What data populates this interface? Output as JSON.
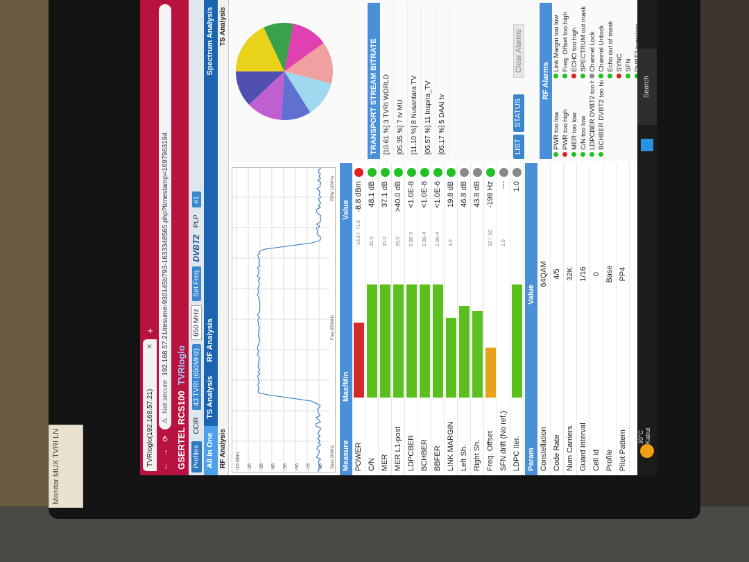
{
  "browser": {
    "tab_title": "TVRIoglo(192.168.57.21)",
    "not_secure": "Not secure",
    "url": "192.168.57.21/resume-930145b793-1633348565.php?timestamp=1697963194"
  },
  "app": {
    "brand": "GSERTEL RCS100",
    "device": "TVRIoglo"
  },
  "toolbar": {
    "profiles": "Profiles",
    "ccir": "CCIR",
    "channel": "43 TVRI (650MHz)",
    "freq": "650 MHz",
    "set_freq": "Set Freq",
    "dvb": "DVBT2",
    "plp": "PLP",
    "plp_val": "#1"
  },
  "tabs": {
    "all_in_one": "All In One",
    "ts_analysis": "TS Analysis",
    "rf_analysis": "RF Analysis",
    "spectrum": "Spectrum Analysis",
    "ts_analysis2": "TS Analysis",
    "rf_sub": "RF Analysis"
  },
  "spectrum": {
    "freq_label": "Freq 650MHz",
    "span_label": "Span 20MHz",
    "rbw_label": "RBW 160KHz",
    "yticks": [
      "-16 dBm",
      "-26",
      "-36",
      "-46",
      "-56",
      "-66",
      "-76",
      "-86"
    ]
  },
  "measure": {
    "header": "Measure",
    "header_val": "Max/Min",
    "header_v2": "Value",
    "rows": [
      {
        "label": "POWER",
        "value": "-8.8 dBm",
        "lim": "-16.9 / -71.9",
        "fill": 0.45,
        "color": "#d42a2a",
        "led": "#e02020"
      },
      {
        "label": "C/N",
        "value": "48.1 dB",
        "lim": "20.0",
        "fill": 0.68,
        "color": "#5bbf1e",
        "led": "#22c022"
      },
      {
        "label": "MER",
        "value": "37.1 dB",
        "lim": "25.0",
        "fill": 0.68,
        "color": "#5bbf1e",
        "led": "#22c022"
      },
      {
        "label": "MER L1-post",
        "value": ">40.0 dB",
        "lim": "25.0",
        "fill": 0.68,
        "color": "#5bbf1e",
        "led": "#22c022"
      },
      {
        "label": "LDPCBER",
        "value": "<1.0E-8",
        "lim": "5.0E-3",
        "fill": 0.68,
        "color": "#5bbf1e",
        "led": "#22c022"
      },
      {
        "label": "BCHBER",
        "value": "<1.0E-8",
        "lim": "2.0E-4",
        "fill": 0.68,
        "color": "#5bbf1e",
        "led": "#22c022"
      },
      {
        "label": "BBFER",
        "value": "<1.0E-6",
        "lim": "2.0E-4",
        "fill": 0.68,
        "color": "#5bbf1e",
        "led": "#22c022"
      },
      {
        "label": "LINK MARGIN",
        "value": "19.8 dB",
        "lim": "3.0",
        "fill": 0.48,
        "color": "#5bbf1e",
        "led": "#22c022"
      },
      {
        "label": "Left Sh.",
        "value": "46.8 dB",
        "lim": "",
        "fill": 0.55,
        "color": "#5bbf1e",
        "led": "#888888"
      },
      {
        "label": "Right Sh.",
        "value": "43.8 dB",
        "lim": "",
        "fill": 0.52,
        "color": "#5bbf1e",
        "led": "#888888"
      },
      {
        "label": "Freq. Offset",
        "value": "-198 Hz",
        "lim": "10 / -10",
        "fill": 0.3,
        "color": "#e8a21a",
        "led": "#22c022"
      },
      {
        "label": "SFN drift (No ref.)",
        "value": "---",
        "lim": "1.0",
        "fill": 0.0,
        "color": "#5bbf1e",
        "led": "#888888"
      },
      {
        "label": "LDPC Iter.",
        "value": "1.0",
        "lim": "",
        "fill": 0.68,
        "color": "#5bbf1e",
        "led": "#888888"
      }
    ]
  },
  "params": {
    "header": "Param",
    "header_val": "Value",
    "rows": [
      {
        "label": "Constellation",
        "value": "64QAM"
      },
      {
        "label": "Code Rate",
        "value": "4/5"
      },
      {
        "label": "Num Carriers",
        "value": "32K"
      },
      {
        "label": "Guard Interval",
        "value": "1/16"
      },
      {
        "label": "Cell Id",
        "value": "0"
      },
      {
        "label": "Profile",
        "value": "Base"
      },
      {
        "label": "Pilot Pattern",
        "value": "PP4"
      }
    ]
  },
  "ts_bitrate": {
    "title": "TRANSPORT STREAM BITRATE",
    "items": [
      "[10.61 %] 3 TVRI WORLD",
      "[05.35 %] 7 tv MU",
      "[11.10 %] 8 Nusantara TV",
      "[05.57 %] 11 Inspira_TV",
      "[05.17 %] 5 DAAI tv"
    ]
  },
  "pie": {
    "slices": [
      {
        "v": 18,
        "c": "#e8d21a"
      },
      {
        "v": 10,
        "c": "#3aa04a"
      },
      {
        "v": 12,
        "c": "#e040b0"
      },
      {
        "v": 14,
        "c": "#f0a0a0"
      },
      {
        "v": 12,
        "c": "#a0d8f0"
      },
      {
        "v": 10,
        "c": "#6070d0"
      },
      {
        "v": 12,
        "c": "#c060d0"
      },
      {
        "v": 12,
        "c": "#5050b0"
      }
    ]
  },
  "list_buttons": {
    "list": "LIST",
    "status": "STATUS",
    "clear": "Clear Alarms"
  },
  "alarms": {
    "title": "RF Alarms",
    "items": [
      {
        "t": "PWR too low",
        "c": "#22c022"
      },
      {
        "t": "Link Margin too low",
        "c": "#22c022"
      },
      {
        "t": "PWR too high",
        "c": "#e02020"
      },
      {
        "t": "Freq. Offset too high",
        "c": "#22c022"
      },
      {
        "t": "MER too low",
        "c": "#22c022"
      },
      {
        "t": "ECHO too high",
        "c": "#e02020"
      },
      {
        "t": "C/N too low",
        "c": "#22c022"
      },
      {
        "t": "SPECTRUM out mask",
        "c": "#22c022"
      },
      {
        "t": "LDPCBER DVBT2 too high",
        "c": "#22c022"
      },
      {
        "t": "Channel Lock",
        "c": "#888888"
      },
      {
        "t": "BCHBER DVBT2 too high",
        "c": "#22c022"
      },
      {
        "t": "Channel Unlock",
        "c": "#22c022"
      },
      {
        "t": "",
        "c": ""
      },
      {
        "t": "Echo out of mask",
        "c": "#22c022"
      },
      {
        "t": "",
        "c": ""
      },
      {
        "t": "SYNC",
        "c": "#e02020"
      },
      {
        "t": "",
        "c": ""
      },
      {
        "t": "SFN",
        "c": "#22c022"
      },
      {
        "t": "",
        "c": ""
      },
      {
        "t": "DVBT2 template",
        "c": "#22c022"
      }
    ]
  },
  "taskbar": {
    "temp": "30°C",
    "weather": "Kabut",
    "search": "Search"
  },
  "sticker": {
    "text": "Monitor MUX TVRI LN"
  }
}
